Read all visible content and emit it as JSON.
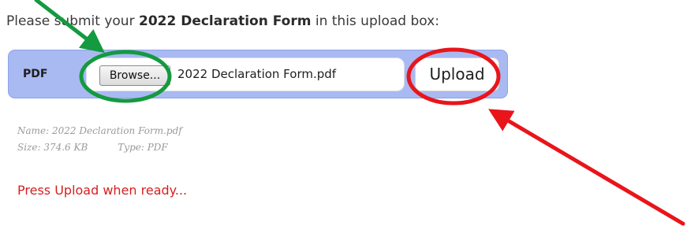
{
  "instruction": {
    "prefix": "Please submit your ",
    "emphasis": "2022 Declaration Form",
    "suffix": " in this upload box:"
  },
  "upload_box": {
    "file_type_label": "PDF",
    "browse_label": "Browse...",
    "selected_file": "2022 Declaration Form.pdf",
    "upload_label": "Upload",
    "bar_color": "#a9b9f2"
  },
  "file_info": {
    "name": "Name: 2022 Declaration Form.pdf",
    "size": "Size: 374.6 KB",
    "type": "Type: PDF"
  },
  "status": {
    "message": "Press Upload when ready...",
    "color": "#d51f1f"
  },
  "annotations": {
    "browse_highlight_color": "#149a3f",
    "upload_highlight_color": "#e8151b"
  }
}
